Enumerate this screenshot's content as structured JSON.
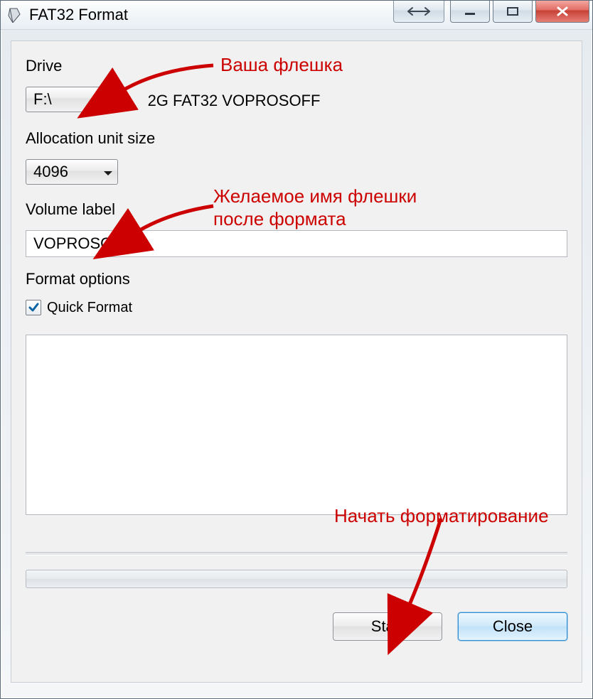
{
  "window": {
    "title": "FAT32 Format"
  },
  "form": {
    "drive_label": "Drive",
    "drive_value": "F:\\",
    "drive_info": "2G FAT32 VOPROSOFF",
    "alloc_label": "Allocation unit size",
    "alloc_value": "4096",
    "volume_label_label": "Volume label",
    "volume_label_value": "VOPROSOFF",
    "format_options_label": "Format options",
    "quick_format_label": "Quick Format",
    "quick_format_checked": true
  },
  "buttons": {
    "start": "Start",
    "close": "Close"
  },
  "annotations": {
    "a1": "Ваша флешка",
    "a2_line1": "Желаемое имя флешки",
    "a2_line2": "после формата",
    "a3": "Начать форматирование"
  }
}
